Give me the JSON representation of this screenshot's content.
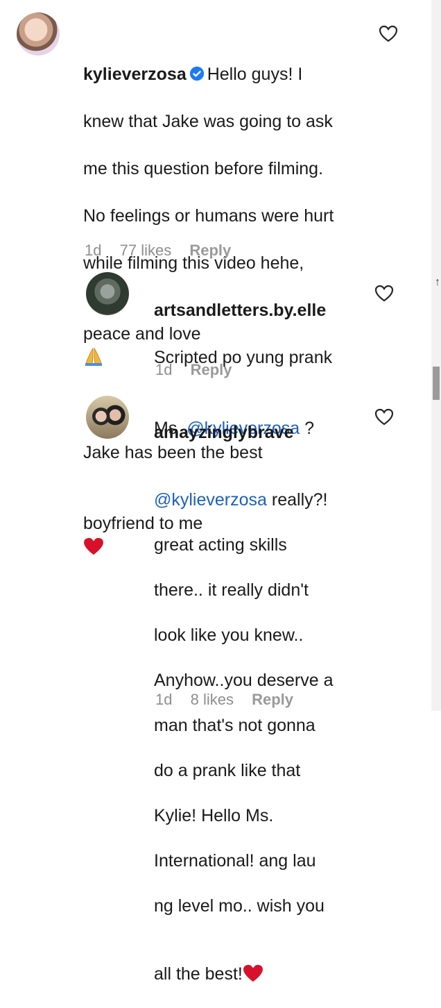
{
  "comments": [
    {
      "username": "kylieverzosa",
      "verified": true,
      "text_lines": [
        "Hello guys! I",
        "knew that Jake was going to ask",
        "me this question before filming.",
        "No feelings or humans were hurt",
        "while filming this video hehe,",
        "peace and love"
      ],
      "text_lines_b": [
        "Jake has been the best",
        "boyfriend to me"
      ],
      "emoji_1": "folded-hands",
      "emoji_2": "red-heart",
      "time": "1d",
      "likes": "77 likes",
      "reply": "Reply"
    },
    {
      "username": "artsandletters.by.elle",
      "text_line1": "Scripted po yung prank",
      "text_pre": "Ms .",
      "mention": "@kylieverzosa",
      "text_post": " ?",
      "time": "1d",
      "reply": "Reply"
    },
    {
      "username": "amayzinglybrave",
      "mention": "@kylieverzosa",
      "text_after_mention": " really?!",
      "text_lines": [
        "great acting skills",
        "there.. it really didn't",
        "look like you knew..",
        "Anyhow..you deserve a",
        "man that's not gonna",
        "do a prank like that",
        "Kylie! Hello Ms.",
        "International! ang lau",
        "ng level mo.. wish you",
        "all the best!"
      ],
      "emoji": "red-heart",
      "time": "1d",
      "likes": "8 likes",
      "reply": "Reply"
    }
  ],
  "icons": {
    "like": "heart-outline-icon",
    "verified": "verified-badge-icon"
  },
  "colors": {
    "mention": "#1d5fbf",
    "verified": "#1d7bf0",
    "heart": "#d9102b",
    "meta": "#8e8e8e"
  }
}
